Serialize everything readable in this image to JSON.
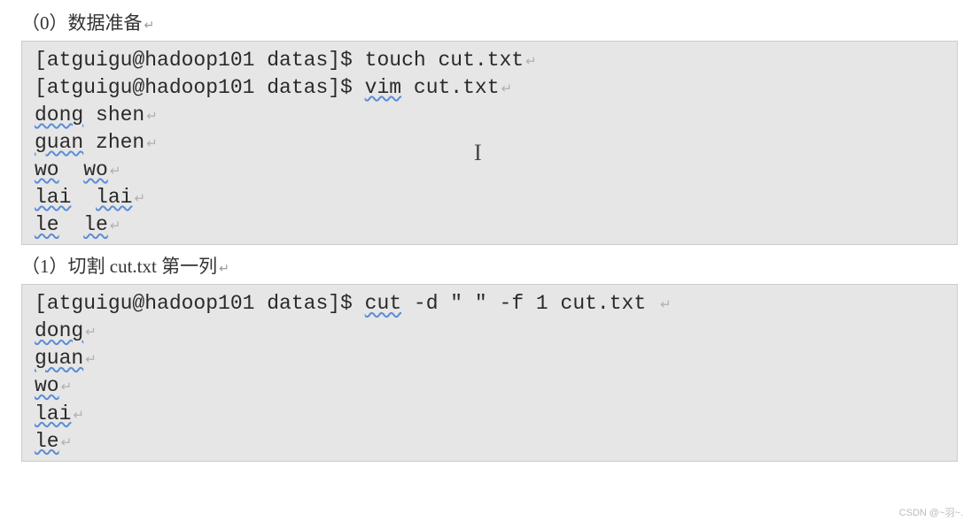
{
  "section0": {
    "title": "（0）数据准备",
    "lines": {
      "prompt1_pre": "[atguigu@hadoop101 datas]$ ",
      "prompt1_cmd": "touch cut.txt",
      "prompt2_pre": "[atguigu@hadoop101 datas]$ ",
      "prompt2_cmd": "vim",
      "prompt2_post": " cut.txt",
      "d1a": "dong",
      "d1b": " shen",
      "d2a": "guan",
      "d2b": " zhen",
      "d3a": "wo",
      "d3sp": "  ",
      "d3b": "wo",
      "d4a": "lai",
      "d4sp": "  ",
      "d4b": "lai",
      "d5a": "le",
      "d5sp": "  ",
      "d5b": "le"
    }
  },
  "section1": {
    "title": "（1）切割 cut.txt 第一列",
    "lines": {
      "prompt_pre": "[atguigu@hadoop101 datas]$ ",
      "cmd": "cut",
      "post": " -d \" \" -f 1 cut.txt ",
      "o1": "dong",
      "o2": "guan",
      "o3": "wo",
      "o4": "lai",
      "o5": "le"
    }
  },
  "return_mark": "↵",
  "cursor": "I",
  "watermark": "CSDN @~羽~."
}
